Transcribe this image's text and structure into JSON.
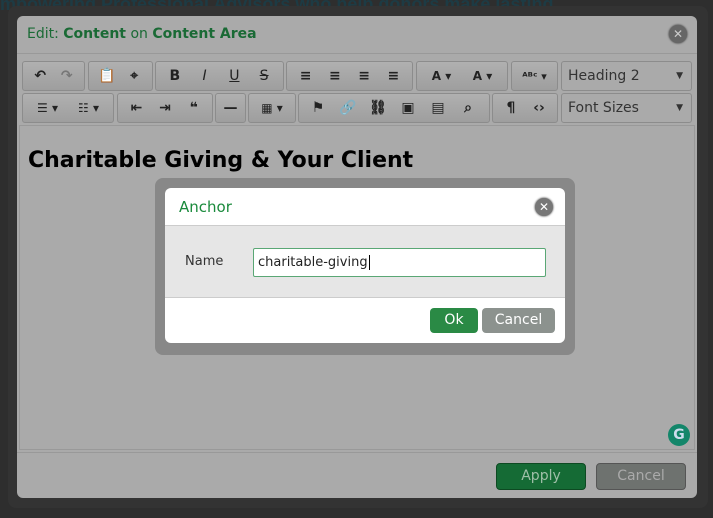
{
  "background": {
    "text": "mpowering Professional Advisors who help donors make lasting"
  },
  "dialog": {
    "title_prefix": "Edit: ",
    "title_content": "Content",
    "title_on": " on ",
    "title_area": "Content Area",
    "close": "✕"
  },
  "toolbar": {
    "row1": [
      "↶",
      "↷",
      "📋",
      "⌖",
      "B",
      "I",
      "U",
      "S",
      "≡",
      "≡",
      "≡",
      "≡",
      "A ▾",
      "A ▾",
      "ᴬᴮᶜ ▾"
    ],
    "row2": [
      "☰ ▾",
      "☷ ▾",
      "⇤",
      "⇥",
      "❝",
      "—",
      "▦ ▾",
      "⚑",
      "🔗",
      "⛓",
      "▣",
      "▤",
      "⌕",
      "¶",
      "‹›"
    ],
    "format_select": "Heading 2",
    "size_select": "Font Sizes"
  },
  "editor": {
    "heading": "Charitable Giving & Your Client"
  },
  "footer": {
    "apply": "Apply",
    "cancel": "Cancel"
  },
  "anchor": {
    "title": "Anchor",
    "name_label": "Name",
    "name_value": "charitable-giving",
    "ok": "Ok",
    "cancel": "Cancel"
  },
  "colors": {
    "accent": "#1a8a3c",
    "apply": "#156b35",
    "grammarly": "#13866a"
  }
}
